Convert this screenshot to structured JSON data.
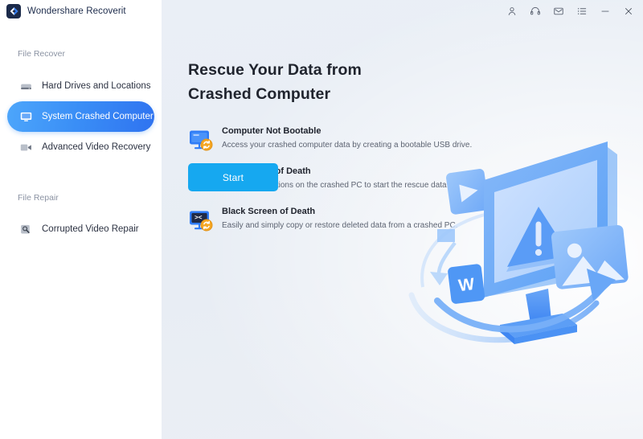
{
  "window": {
    "brand": "Wondershare Recoverit",
    "logo_icon": "wondershare-diamond-logo",
    "titlebar_buttons": [
      {
        "name": "account-icon",
        "label": "Account"
      },
      {
        "name": "support-headset-icon",
        "label": "Support"
      },
      {
        "name": "mail-icon",
        "label": "Feedback"
      },
      {
        "name": "menu-list-icon",
        "label": "Menu"
      },
      {
        "name": "minimize-icon",
        "label": "Minimize"
      },
      {
        "name": "close-icon",
        "label": "Close"
      }
    ]
  },
  "sidebar": {
    "groups": [
      {
        "title": "File Recover",
        "items": [
          {
            "label": "Hard Drives and Locations",
            "icon": "hard-drive-icon",
            "active": false
          },
          {
            "label": "System Crashed Computer",
            "icon": "monitor-icon",
            "active": true
          },
          {
            "label": "Advanced Video Recovery",
            "icon": "video-camera-icon",
            "active": false
          }
        ]
      },
      {
        "title": "File Repair",
        "items": [
          {
            "label": "Corrupted Video Repair",
            "icon": "video-repair-icon",
            "active": false
          }
        ]
      }
    ]
  },
  "main": {
    "headline": "Rescue Your Data from Crashed Computer",
    "features": [
      {
        "title": "Computer Not Bootable",
        "desc": "Access your crashed computer data by creating a bootable USB drive.",
        "icon": "monitor-blue-refresh-icon"
      },
      {
        "title": "Blue Screen of Death",
        "desc": "Set the boot options on the crashed PC to start the rescue data.",
        "icon": "monitor-blue-sadface-refresh-icon"
      },
      {
        "title": "Black Screen of Death",
        "desc": "Easily and simply copy or restore deleted data from a crashed PC.",
        "icon": "monitor-black-sadface-refresh-icon"
      }
    ],
    "start_label": "Start",
    "illustration": {
      "name": "crashed-monitor-illustration",
      "word_badge": "W",
      "warning_symbol": "!"
    }
  },
  "colors": {
    "accent": "#16a8f0",
    "sidebar_active_from": "#4da6fb",
    "sidebar_active_to": "#2f73f0",
    "main_bg": "#e9eef5",
    "badge_orange": "#f5a623",
    "screen_blue": "#2f7cf6",
    "screen_black": "#1f2a47"
  }
}
